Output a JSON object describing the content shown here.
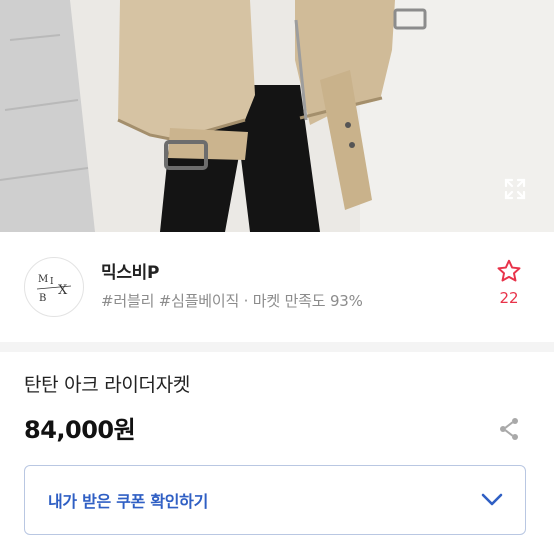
{
  "photo": {
    "alt": "",
    "expand_icon": "expand-icon"
  },
  "shop": {
    "logo_letters": [
      "M",
      "I",
      "X",
      "B"
    ],
    "name": "믹스비P",
    "meta": "#러블리 #심플베이직 · 마켓 만족도 93%",
    "favorite_icon": "star-outline-icon",
    "favorite_count": "22",
    "accent_color": "#e8334a"
  },
  "product": {
    "title": "탄탄 아크 라이더자켓",
    "price": "84,000원",
    "share_icon": "share-icon"
  },
  "coupon": {
    "label": "내가 받은 쿠폰 확인하기",
    "chevron_icon": "chevron-down-icon",
    "color": "#2f5fc4"
  }
}
